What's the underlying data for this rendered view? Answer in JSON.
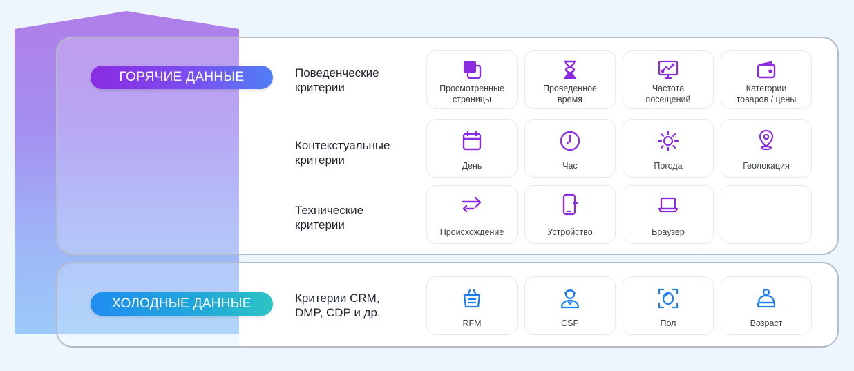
{
  "hot": {
    "title": "ГОРЯЧИЕ ДАННЫЕ",
    "rows": [
      {
        "criterion_line1": "Поведенческие",
        "criterion_line2": "критерии",
        "cards": [
          {
            "icon": "pages-icon",
            "line1": "Просмотренные",
            "line2": "страницы"
          },
          {
            "icon": "hourglass-icon",
            "line1": "Проведенное",
            "line2": "время"
          },
          {
            "icon": "chart-monitor-icon",
            "line1": "Частота",
            "line2": "посещений"
          },
          {
            "icon": "wallet-icon",
            "line1": "Категории",
            "line2": "товаров / цены"
          }
        ]
      },
      {
        "criterion_line1": "Контекстуальные",
        "criterion_line2": "критерии",
        "cards": [
          {
            "icon": "calendar-icon",
            "line1": "День"
          },
          {
            "icon": "clock-icon",
            "line1": "Час"
          },
          {
            "icon": "sun-icon",
            "line1": "Погода"
          },
          {
            "icon": "geo-pin-icon",
            "line1": "Геолокация"
          }
        ]
      },
      {
        "criterion_line1": "Технические",
        "criterion_line2": "критерии",
        "cards": [
          {
            "icon": "arrows-icon",
            "line1": "Происхождение"
          },
          {
            "icon": "phone-icon",
            "line1": "Устройство"
          },
          {
            "icon": "laptop-icon",
            "line1": "Браузер"
          }
        ]
      }
    ]
  },
  "cold": {
    "title": "ХОЛОДНЫЕ ДАННЫЕ",
    "criterion_line1": "Критерии CRM,",
    "criterion_line2": "DMP, CDP и др.",
    "cards": [
      {
        "icon": "basket-icon",
        "line1": "RFM"
      },
      {
        "icon": "user-icon",
        "line1": "CSP"
      },
      {
        "icon": "face-scan-icon",
        "line1": "Пол"
      },
      {
        "icon": "person-age-icon",
        "line1": "Возраст"
      }
    ]
  },
  "colors": {
    "hot_icon": "#8a2be2",
    "cold_icon": "#1e7ff0",
    "panel_border": "#b5bcc9"
  }
}
